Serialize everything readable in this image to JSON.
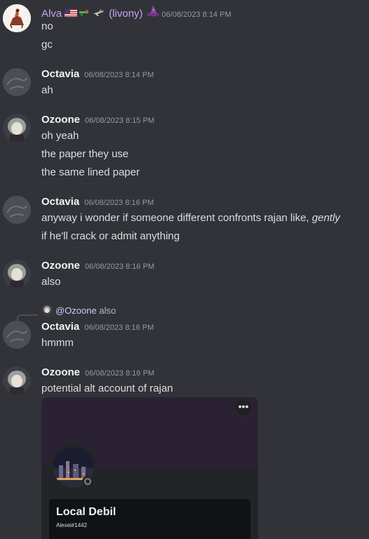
{
  "messages": [
    {
      "author": "Alva",
      "author_suffix": "(livony)",
      "author_color": "#c9a1f5",
      "timestamp": "06/08/2023 8:14 PM",
      "lines": [
        "no",
        "gc"
      ]
    },
    {
      "author": "Octavia",
      "timestamp": "06/08/2023 8:14 PM",
      "lines": [
        "ah"
      ]
    },
    {
      "author": "Ozoone",
      "timestamp": "06/08/2023 8:15 PM",
      "lines": [
        "oh yeah",
        "the paper they use",
        "the same lined paper"
      ]
    },
    {
      "author": "Octavia",
      "timestamp": "06/08/2023 8:16 PM",
      "lines": [
        "anyway i wonder if someone different confronts rajan like, ",
        "if he'll crack or admit anything"
      ],
      "italic_word": "gently"
    },
    {
      "author": "Ozoone",
      "timestamp": "06/08/2023 8:16 PM",
      "lines": [
        "also"
      ]
    },
    {
      "reply": {
        "mention": "@Ozoone",
        "text": "also"
      },
      "author": "Octavia",
      "timestamp": "06/08/2023 8:16 PM",
      "lines": [
        "hmmm"
      ]
    },
    {
      "author": "Ozoone",
      "timestamp": "06/08/2023 8:16 PM",
      "lines": [
        "potential alt account of rajan"
      ]
    }
  ],
  "embed": {
    "more_label": "•••",
    "display_name": "Local Debil",
    "tag": "Alexei#1442"
  },
  "colors": {
    "background": "#313338",
    "author_name": "#f2f3f5",
    "timestamp": "#949ba4",
    "alva_name": "#c9a1f5"
  },
  "icons": [
    "us-flag-icon",
    "gun-icon",
    "airplane-icon",
    "wizard-hat-icon",
    "more-options-icon"
  ]
}
